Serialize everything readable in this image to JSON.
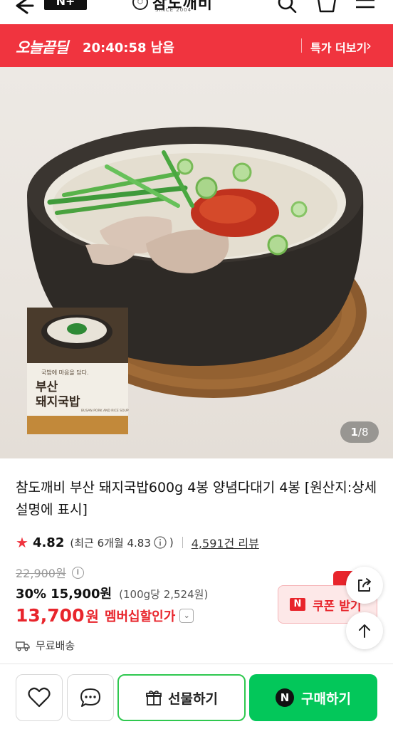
{
  "header": {
    "brand_mark": "N+",
    "store_name": "참도깨비",
    "store_since": "SINCE 2004",
    "icons": [
      "back-arrow-icon",
      "search-icon",
      "cart-icon",
      "menu-icon"
    ]
  },
  "deal_bar": {
    "logo": "오늘끝딜",
    "timer": "20:40:58 남음",
    "more_label": "특가 더보기",
    "bg_color": "#f0343f"
  },
  "gallery": {
    "current": "1",
    "total": "8",
    "separator": "/",
    "package_title": "부산\n돼지국밥",
    "package_tagline": "국밥에 마음을 담다.",
    "package_en": "BUSAN PORK AND RICE SOUP"
  },
  "product": {
    "title": "참도깨비 부산 돼지국밥600g 4봉 양념다대기 4봉 [원산지:상세설명에 표시]",
    "rating": "4.82",
    "recent_rating": "(최근 6개월 4.83",
    "recent_close": ")",
    "review_count": "4,591건 리뷰",
    "original_price": "22,900원",
    "discount_pct": "30%",
    "sale_price": "15,900원",
    "unit_price": "(100g당 2,524원)",
    "member_price": "13,700",
    "member_won": "원",
    "member_label": "멤버십할인가",
    "shipping": "무료배송"
  },
  "coupon": {
    "label": "쿠폰 받기",
    "icon_letter": "N"
  },
  "bottom_bar": {
    "gift_label": "선물하기",
    "buy_label": "구매하기",
    "buy_icon_letter": "N",
    "buy_color": "#03c75a"
  }
}
